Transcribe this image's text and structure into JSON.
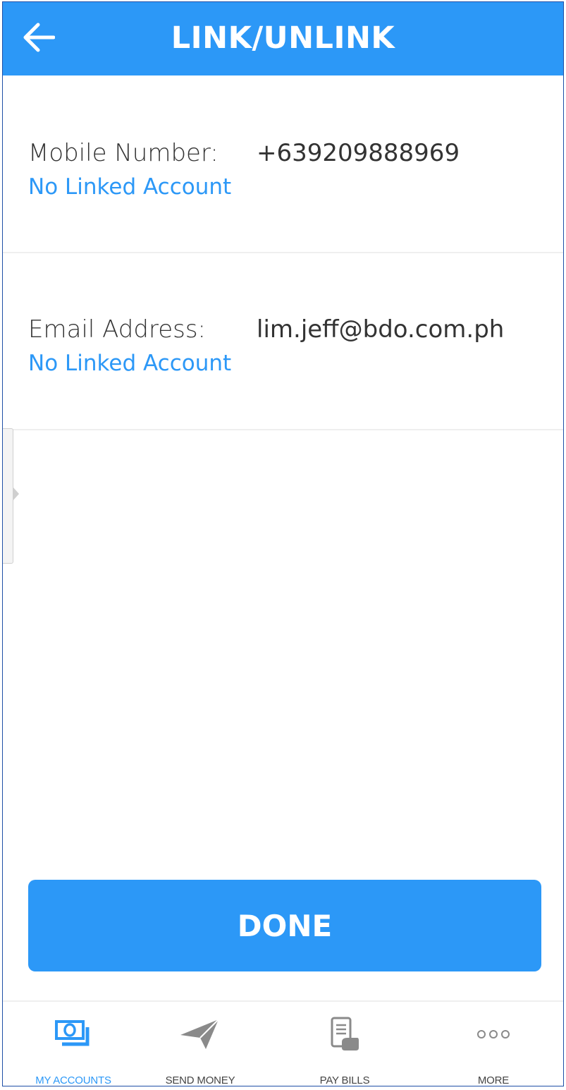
{
  "header": {
    "title": "LINK/UNLINK",
    "back_icon": "arrow-left-icon"
  },
  "mobile": {
    "label": "Mobile Number:",
    "value": "+639209888969",
    "status": "No Linked Account"
  },
  "email": {
    "label": "Email Address:",
    "value": "lim.jeff@bdo.com.ph",
    "status": "No Linked Account"
  },
  "done_button": {
    "label": "DONE"
  },
  "tabs": [
    {
      "label": "MY ACCOUNTS",
      "icon": "money-icon",
      "active": true
    },
    {
      "label": "SEND MONEY",
      "icon": "paper-plane-icon",
      "active": false
    },
    {
      "label": "PAY BILLS",
      "icon": "receipt-icon",
      "active": false
    },
    {
      "label": "MORE",
      "icon": "more-dots-icon",
      "active": false
    }
  ],
  "colors": {
    "accent": "#2c98f7",
    "text": "#333333",
    "inactive_icon": "#8a8a8a"
  }
}
